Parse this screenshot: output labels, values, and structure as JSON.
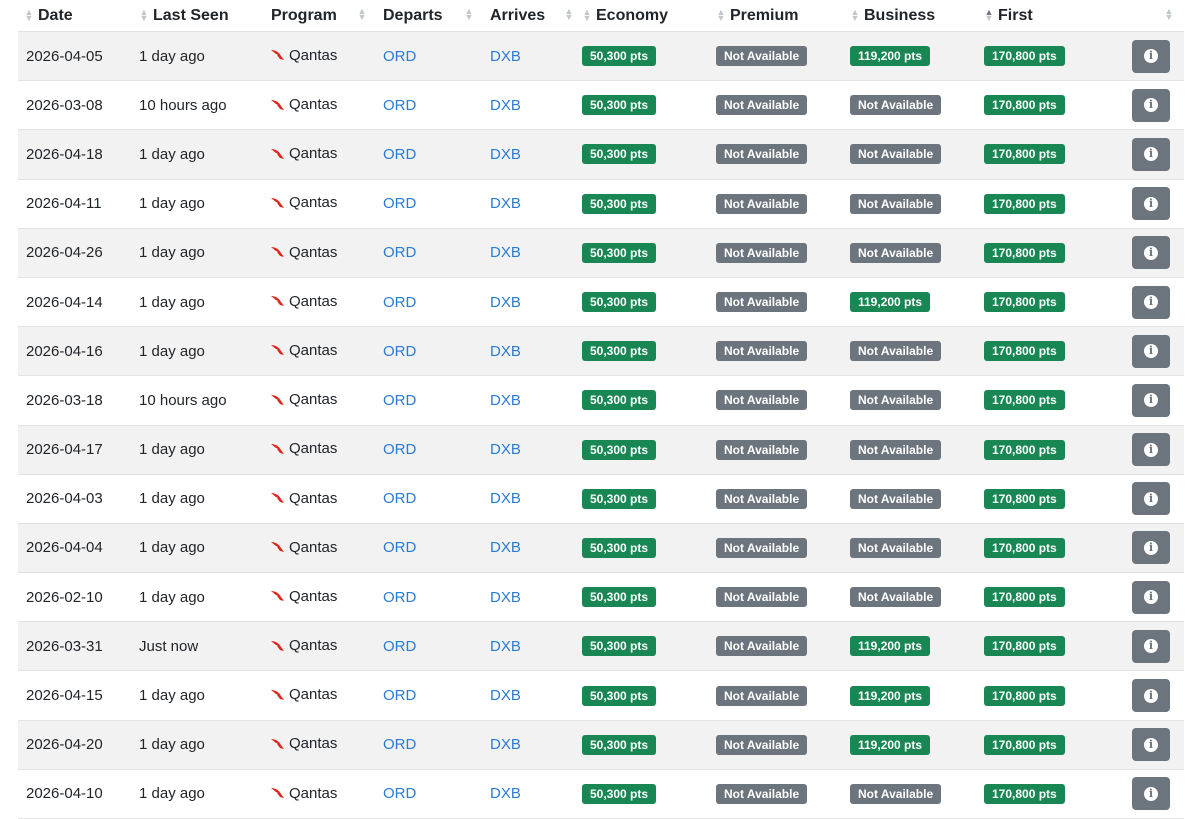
{
  "columns": [
    {
      "key": "date",
      "label": "Date",
      "sort": "none"
    },
    {
      "key": "last_seen",
      "label": "Last Seen",
      "sort": "none"
    },
    {
      "key": "program",
      "label": "Program",
      "sort": "none"
    },
    {
      "key": "departs",
      "label": "Departs",
      "sort": "none"
    },
    {
      "key": "arrives",
      "label": "Arrives",
      "sort": "none"
    },
    {
      "key": "economy",
      "label": "Economy",
      "sort": "none"
    },
    {
      "key": "premium",
      "label": "Premium",
      "sort": "none"
    },
    {
      "key": "business",
      "label": "Business",
      "sort": "none"
    },
    {
      "key": "first",
      "label": "First",
      "sort": "ascending"
    }
  ],
  "colors": {
    "available": "#198754",
    "unavailable": "#6c757d",
    "link": "#2a7bd3",
    "stripe": "#f2f2f2"
  },
  "icons": {
    "program": "qantas-logo-icon",
    "details": "info-circle-icon",
    "sort": "sort-arrows-icon"
  },
  "rows": [
    {
      "date": "2026-04-05",
      "last_seen": "1 day ago",
      "program": "Qantas",
      "departs": "ORD",
      "arrives": "DXB",
      "economy": "50,300 pts",
      "premium": "Not Available",
      "business": "119,200 pts",
      "first": "170,800 pts"
    },
    {
      "date": "2026-03-08",
      "last_seen": "10 hours ago",
      "program": "Qantas",
      "departs": "ORD",
      "arrives": "DXB",
      "economy": "50,300 pts",
      "premium": "Not Available",
      "business": "Not Available",
      "first": "170,800 pts"
    },
    {
      "date": "2026-04-18",
      "last_seen": "1 day ago",
      "program": "Qantas",
      "departs": "ORD",
      "arrives": "DXB",
      "economy": "50,300 pts",
      "premium": "Not Available",
      "business": "Not Available",
      "first": "170,800 pts"
    },
    {
      "date": "2026-04-11",
      "last_seen": "1 day ago",
      "program": "Qantas",
      "departs": "ORD",
      "arrives": "DXB",
      "economy": "50,300 pts",
      "premium": "Not Available",
      "business": "Not Available",
      "first": "170,800 pts"
    },
    {
      "date": "2026-04-26",
      "last_seen": "1 day ago",
      "program": "Qantas",
      "departs": "ORD",
      "arrives": "DXB",
      "economy": "50,300 pts",
      "premium": "Not Available",
      "business": "Not Available",
      "first": "170,800 pts"
    },
    {
      "date": "2026-04-14",
      "last_seen": "1 day ago",
      "program": "Qantas",
      "departs": "ORD",
      "arrives": "DXB",
      "economy": "50,300 pts",
      "premium": "Not Available",
      "business": "119,200 pts",
      "first": "170,800 pts"
    },
    {
      "date": "2026-04-16",
      "last_seen": "1 day ago",
      "program": "Qantas",
      "departs": "ORD",
      "arrives": "DXB",
      "economy": "50,300 pts",
      "premium": "Not Available",
      "business": "Not Available",
      "first": "170,800 pts"
    },
    {
      "date": "2026-03-18",
      "last_seen": "10 hours ago",
      "program": "Qantas",
      "departs": "ORD",
      "arrives": "DXB",
      "economy": "50,300 pts",
      "premium": "Not Available",
      "business": "Not Available",
      "first": "170,800 pts"
    },
    {
      "date": "2026-04-17",
      "last_seen": "1 day ago",
      "program": "Qantas",
      "departs": "ORD",
      "arrives": "DXB",
      "economy": "50,300 pts",
      "premium": "Not Available",
      "business": "Not Available",
      "first": "170,800 pts"
    },
    {
      "date": "2026-04-03",
      "last_seen": "1 day ago",
      "program": "Qantas",
      "departs": "ORD",
      "arrives": "DXB",
      "economy": "50,300 pts",
      "premium": "Not Available",
      "business": "Not Available",
      "first": "170,800 pts"
    },
    {
      "date": "2026-04-04",
      "last_seen": "1 day ago",
      "program": "Qantas",
      "departs": "ORD",
      "arrives": "DXB",
      "economy": "50,300 pts",
      "premium": "Not Available",
      "business": "Not Available",
      "first": "170,800 pts"
    },
    {
      "date": "2026-02-10",
      "last_seen": "1 day ago",
      "program": "Qantas",
      "departs": "ORD",
      "arrives": "DXB",
      "economy": "50,300 pts",
      "premium": "Not Available",
      "business": "Not Available",
      "first": "170,800 pts"
    },
    {
      "date": "2026-03-31",
      "last_seen": "Just now",
      "program": "Qantas",
      "departs": "ORD",
      "arrives": "DXB",
      "economy": "50,300 pts",
      "premium": "Not Available",
      "business": "119,200 pts",
      "first": "170,800 pts"
    },
    {
      "date": "2026-04-15",
      "last_seen": "1 day ago",
      "program": "Qantas",
      "departs": "ORD",
      "arrives": "DXB",
      "economy": "50,300 pts",
      "premium": "Not Available",
      "business": "119,200 pts",
      "first": "170,800 pts"
    },
    {
      "date": "2026-04-20",
      "last_seen": "1 day ago",
      "program": "Qantas",
      "departs": "ORD",
      "arrives": "DXB",
      "economy": "50,300 pts",
      "premium": "Not Available",
      "business": "119,200 pts",
      "first": "170,800 pts"
    },
    {
      "date": "2026-04-10",
      "last_seen": "1 day ago",
      "program": "Qantas",
      "departs": "ORD",
      "arrives": "DXB",
      "economy": "50,300 pts",
      "premium": "Not Available",
      "business": "Not Available",
      "first": "170,800 pts"
    }
  ]
}
